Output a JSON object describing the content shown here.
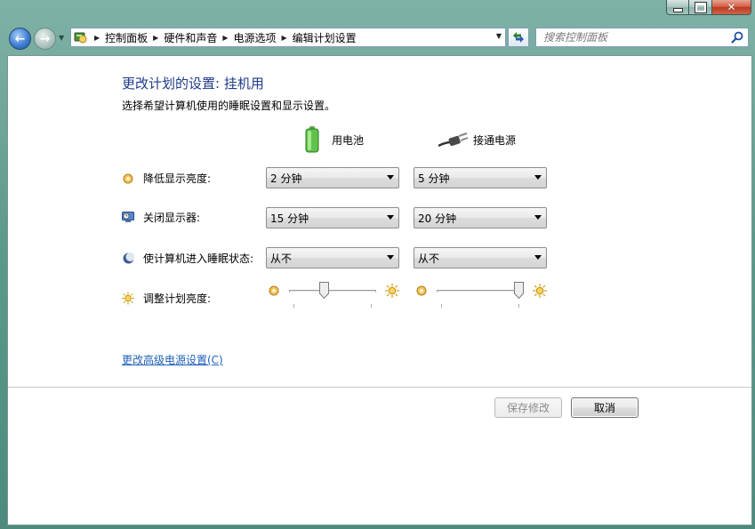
{
  "navigation": {
    "breadcrumbs": [
      "控制面板",
      "硬件和声音",
      "电源选项",
      "编辑计划设置"
    ],
    "search_placeholder": "搜索控制面板"
  },
  "page": {
    "title": "更改计划的设置: 挂机用",
    "subtitle": "选择希望计算机使用的睡眠设置和显示设置。",
    "columns": {
      "battery": "用电池",
      "plugged_in": "接通电源"
    },
    "rows": {
      "dim_display": {
        "label": "降低显示亮度:",
        "battery": "2 分钟",
        "plugged_in": "5 分钟"
      },
      "turn_off_display": {
        "label": "关闭显示器:",
        "battery": "15 分钟",
        "plugged_in": "20 分钟"
      },
      "sleep": {
        "label": "使计算机进入睡眠状态:",
        "battery": "从不",
        "plugged_in": "从不"
      },
      "brightness": {
        "label": "调整计划亮度:",
        "battery_level": 0.4,
        "plugged_in_level": 1.0
      }
    },
    "advanced_link": "更改高级电源设置(C)",
    "buttons": {
      "save": "保存修改",
      "cancel": "取消"
    }
  },
  "icons": {
    "back": "back-arrow-icon",
    "forward": "forward-arrow-icon",
    "control_panel": "control-panel-icon",
    "refresh": "refresh-icon",
    "search": "search-icon",
    "battery": "battery-icon",
    "plug": "power-plug-icon",
    "dim": "dim-display-icon",
    "monitor": "monitor-off-icon",
    "moon": "sleep-moon-icon",
    "sun": "brightness-sun-icon"
  },
  "colors": {
    "title_blue": "#1e3a8a",
    "link_blue": "#1f62b8",
    "frame_teal": "#5e9a8c"
  }
}
